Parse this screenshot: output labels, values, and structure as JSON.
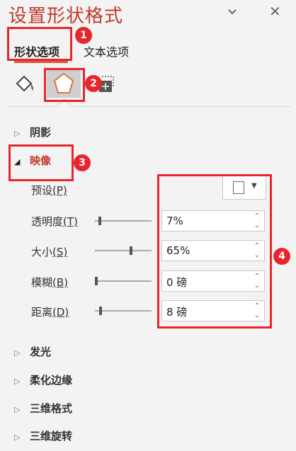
{
  "header": {
    "title": "设置形状格式",
    "collapse_icon": "chevron-down-icon",
    "close_label": "✕"
  },
  "tabs": [
    {
      "label": "形状选项",
      "active": true
    },
    {
      "label": "文本选项",
      "active": false
    }
  ],
  "icon_tabs": [
    {
      "name": "fill-line-icon",
      "active": false
    },
    {
      "name": "effects-pentagon-icon",
      "active": true
    },
    {
      "name": "size-properties-icon",
      "active": false
    }
  ],
  "sections": {
    "shadow": "阴影",
    "reflection": "映像",
    "glow": "发光",
    "soft_edges": "柔化边缘",
    "format_3d": "三维格式",
    "rotation_3d": "三维旋转"
  },
  "reflection": {
    "preset": {
      "label": "预设",
      "key": "(P)"
    },
    "transparency": {
      "label": "透明度",
      "key": "(T)",
      "value": "7%",
      "level_pct": 7
    },
    "size": {
      "label": "大小",
      "key": "(S)",
      "value": "65%",
      "level_pct": 65
    },
    "blur": {
      "label": "模糊",
      "key": "(B)",
      "value": "0 磅",
      "level_pct": 0
    },
    "distance": {
      "label": "距离",
      "key": "(D)",
      "value": "8 磅",
      "level_pct": 8
    }
  },
  "annotations": {
    "b1": "1",
    "b2": "2",
    "b3": "3",
    "b4": "4"
  },
  "colors": {
    "accent": "#c0392b",
    "annotation": "#e8252d",
    "background": "#f3f3f3"
  }
}
